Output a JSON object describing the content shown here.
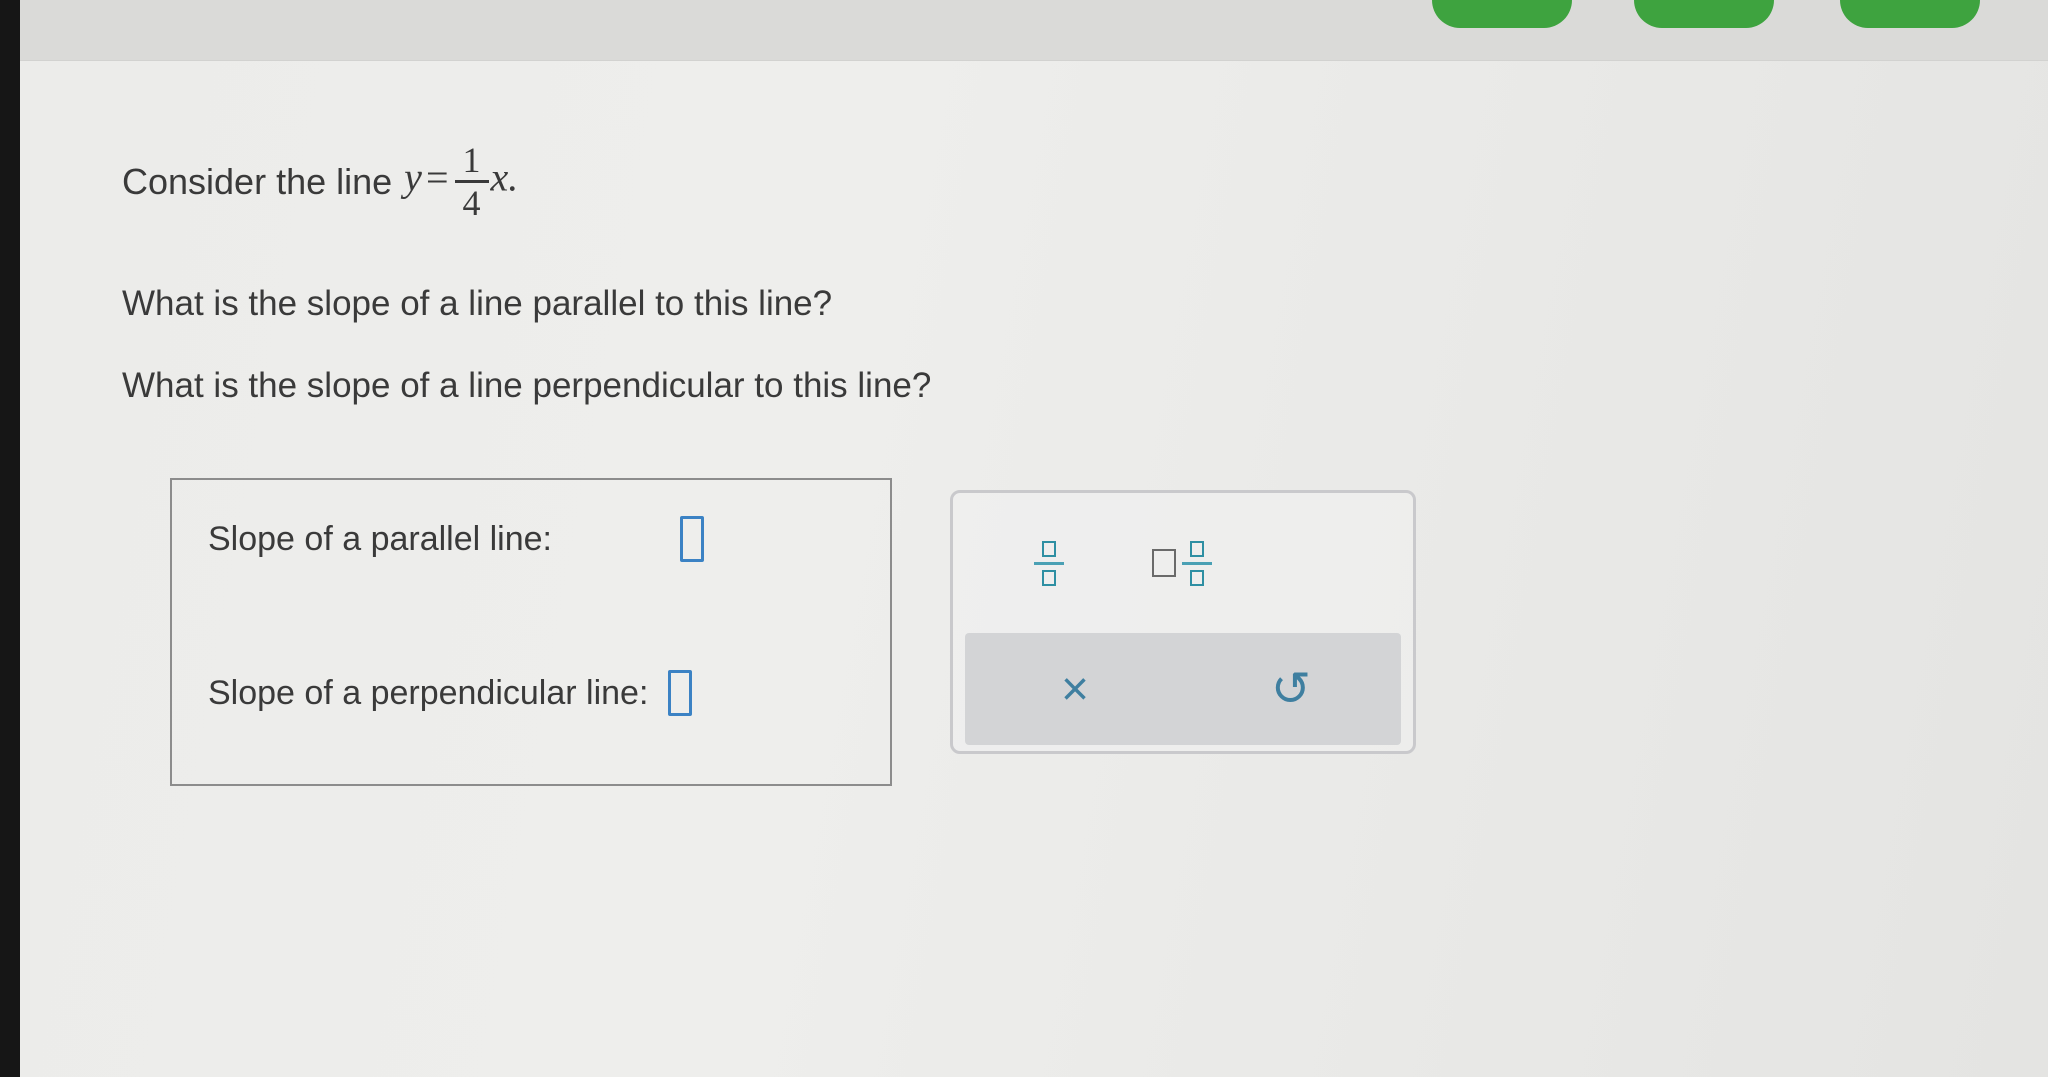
{
  "question": {
    "intro_text": "Consider the line",
    "equation": {
      "lhs": "y",
      "equals": "=",
      "numerator": "1",
      "denominator": "4",
      "variable": "x."
    },
    "prompt_parallel": "What is the slope of a line parallel to this line?",
    "prompt_perpendicular": "What is the slope of a line perpendicular to this line?"
  },
  "answers": {
    "parallel_label": "Slope of a parallel line:",
    "perpendicular_label": "Slope of a perpendicular line:",
    "parallel_value": "",
    "perpendicular_value": ""
  },
  "toolbar": {
    "fraction_icon": "fraction-template-icon",
    "mixed_number_icon": "mixed-number-template-icon",
    "clear_icon": "×",
    "undo_icon": "↺"
  },
  "colors": {
    "input_border": "#3b82c4",
    "template_icon": "#2e8fa3",
    "action_icon": "#3f7fa0",
    "top_buttons": "#3ea33f"
  }
}
